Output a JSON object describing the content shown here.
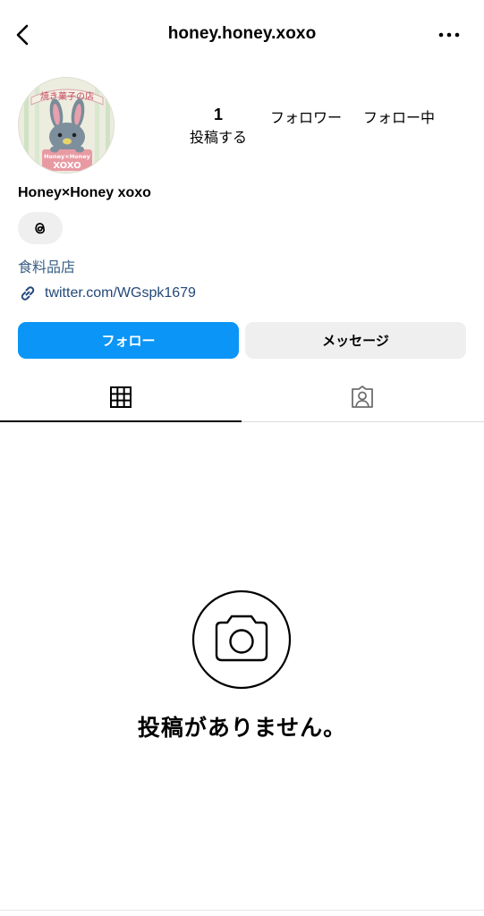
{
  "header": {
    "username": "honey.honey.xoxo",
    "back_icon": "chevron-left-icon",
    "more_icon": "ellipsis-icon"
  },
  "profile": {
    "avatar": {
      "banner_text": "焼き菓子の店",
      "badge_line1": "Honey×Honey",
      "badge_line2": "XOXO"
    },
    "stats": {
      "posts_count": "1",
      "posts_label": "投稿する",
      "followers_label": "フォロワー",
      "following_label": "フォロー中"
    },
    "display_name": "Honey×Honey xoxo",
    "threads_icon": "threads-icon",
    "category": "食料品店",
    "link": "twitter.com/WGspk1679"
  },
  "actions": {
    "follow_label": "フォロー",
    "message_label": "メッセージ"
  },
  "tabs": [
    {
      "icon": "grid-icon",
      "selected": true
    },
    {
      "icon": "tagged-person-icon",
      "selected": false
    }
  ],
  "empty_state": {
    "icon": "camera-icon",
    "message": "投稿がありません。"
  },
  "colors": {
    "primary_button": "#0b95f6",
    "secondary_button": "#efefef",
    "link_text": "#23487a",
    "category_text": "#3a5f85"
  }
}
